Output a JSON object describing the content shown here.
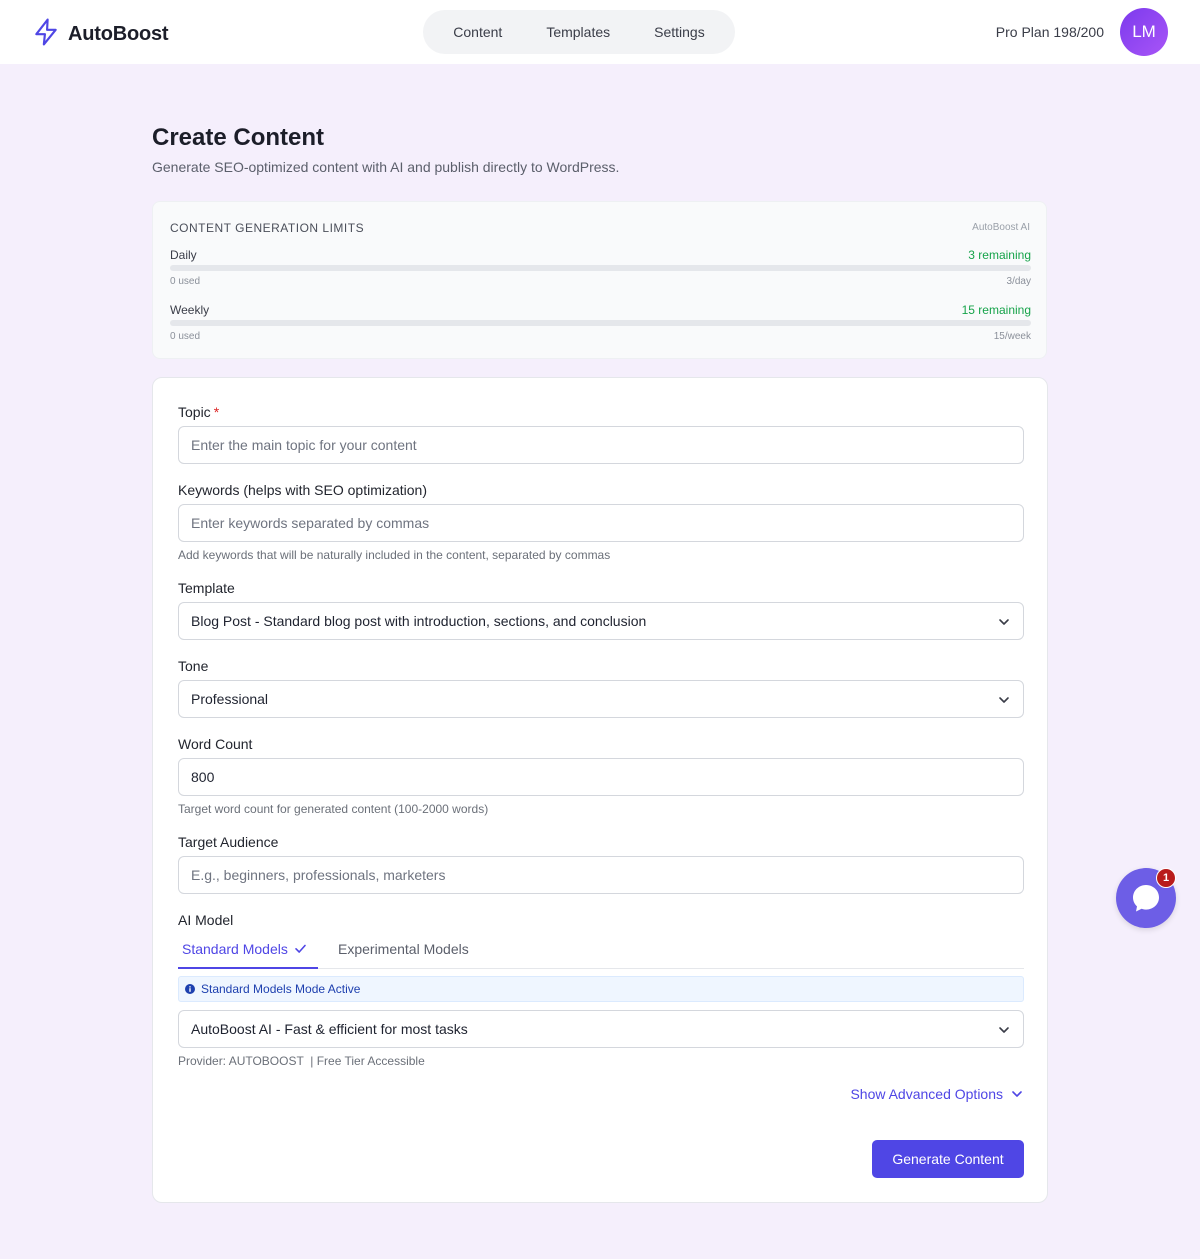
{
  "header": {
    "brand": "AutoBoost",
    "brand_color": "#4f46e5",
    "nav": [
      "Content",
      "Templates",
      "Settings"
    ],
    "plan": "Pro Plan 198/200",
    "avatar_initials": "LM"
  },
  "page": {
    "title": "Create Content",
    "subtitle": "Generate SEO-optimized content with AI and publish directly to WordPress."
  },
  "limits": {
    "title": "CONTENT GENERATION LIMITS",
    "brand": "AutoBoost AI",
    "daily": {
      "label": "Daily",
      "remaining": "3 remaining",
      "used": "0 used",
      "cap": "3/day",
      "fill_fraction": 0
    },
    "weekly": {
      "label": "Weekly",
      "remaining": "15 remaining",
      "used": "0 used",
      "cap": "15/week",
      "fill_fraction": 0
    }
  },
  "form": {
    "topic": {
      "label": "Topic",
      "required_mark": "*",
      "placeholder": "Enter the main topic for your content",
      "value": ""
    },
    "keywords": {
      "label": "Keywords (helps with SEO optimization)",
      "placeholder": "Enter keywords separated by commas",
      "value": "",
      "help": "Add keywords that will be naturally included in the content, separated by commas"
    },
    "template": {
      "label": "Template",
      "selected": "Blog Post - Standard blog post with introduction, sections, and conclusion"
    },
    "tone": {
      "label": "Tone",
      "selected": "Professional"
    },
    "word_count": {
      "label": "Word Count",
      "value": "800",
      "help": "Target word count for generated content (100-2000 words)"
    },
    "audience": {
      "label": "Target Audience",
      "placeholder": "E.g., beginners, professionals, marketers",
      "value": ""
    },
    "ai_model": {
      "label": "AI Model",
      "tabs": [
        "Standard Models",
        "Experimental Models"
      ],
      "active_tab": 0,
      "info": "Standard Models Mode Active",
      "selected": "AutoBoost AI - Fast & efficient for most tasks",
      "provider": "Provider: AUTOBOOST  | Free Tier Accessible"
    },
    "advanced_label": "Show Advanced Options",
    "submit_label": "Generate Content"
  },
  "chat": {
    "badge": "1"
  }
}
